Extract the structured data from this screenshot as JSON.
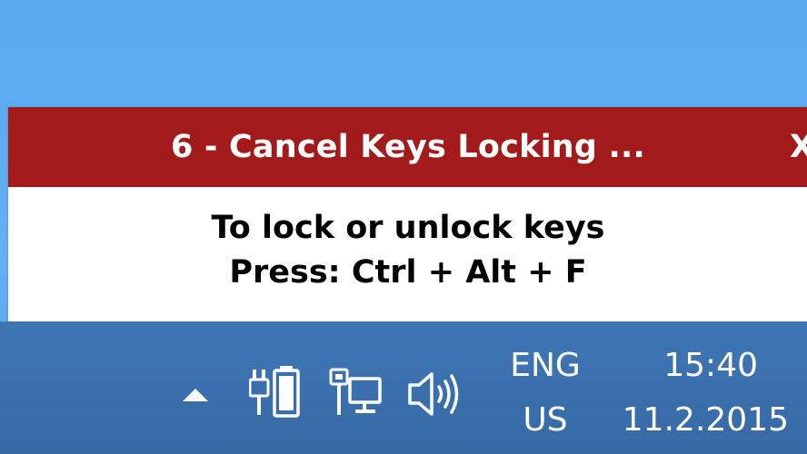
{
  "popup": {
    "title": "6 - Cancel Keys Locking ...",
    "close_label": "X",
    "message_line1": "To lock or unlock keys",
    "message_line2": "Press: Ctrl + Alt + F",
    "header_color": "#a31a1a"
  },
  "taskbar": {
    "tray_icons": [
      "chevron-up-icon",
      "battery-icon",
      "network-icon",
      "volume-icon"
    ],
    "language": {
      "line1": "ENG",
      "line2": "US"
    },
    "clock": {
      "time": "15:40",
      "date": "11.2.2015"
    },
    "color": "#3a70ad"
  },
  "desktop": {
    "color": "#5aa8ee"
  }
}
